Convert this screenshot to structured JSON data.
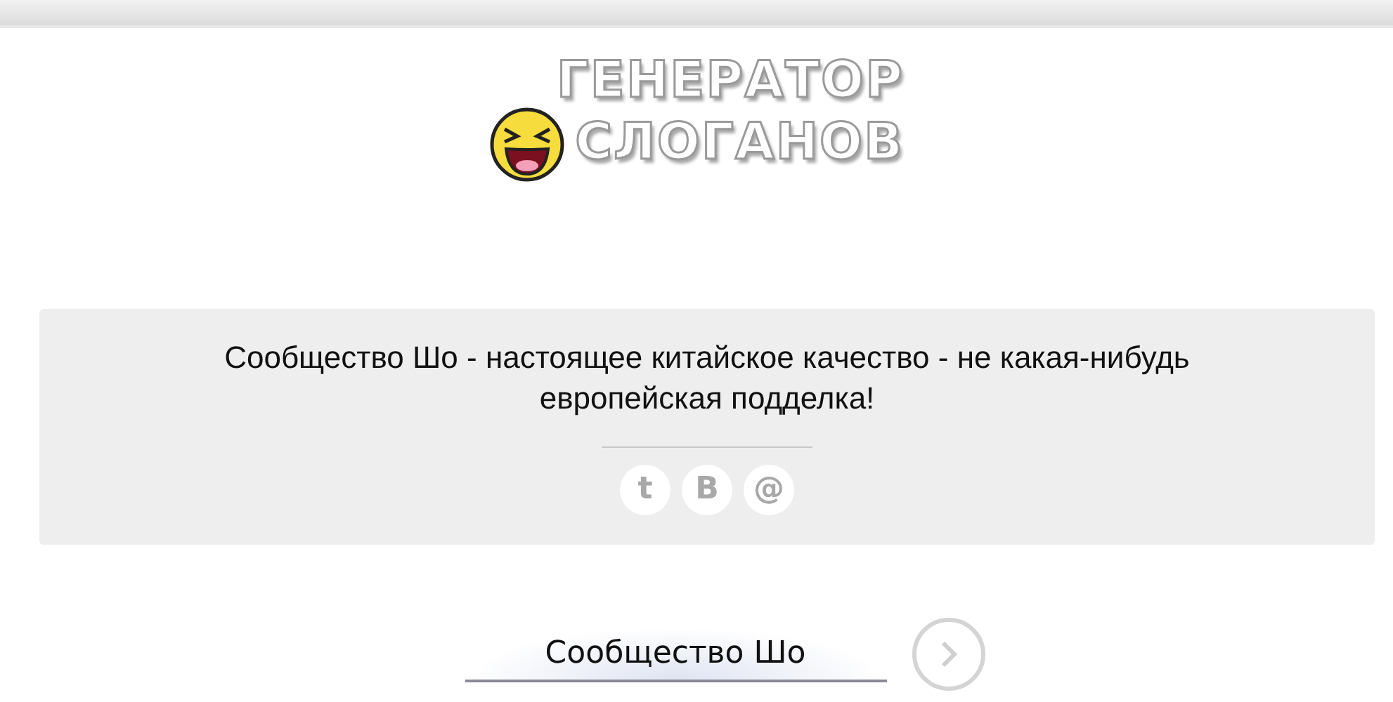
{
  "logo": {
    "lines": [
      "ГЕНЕРАТОР",
      "СЛОГАНОВ"
    ]
  },
  "slogan": "Сообщество Шо - настоящее китайское качество - не какая-нибудь европейская подделка!",
  "share_buttons": [
    "t",
    "B",
    "@"
  ],
  "input": {
    "value": "Сообщество Шо"
  }
}
